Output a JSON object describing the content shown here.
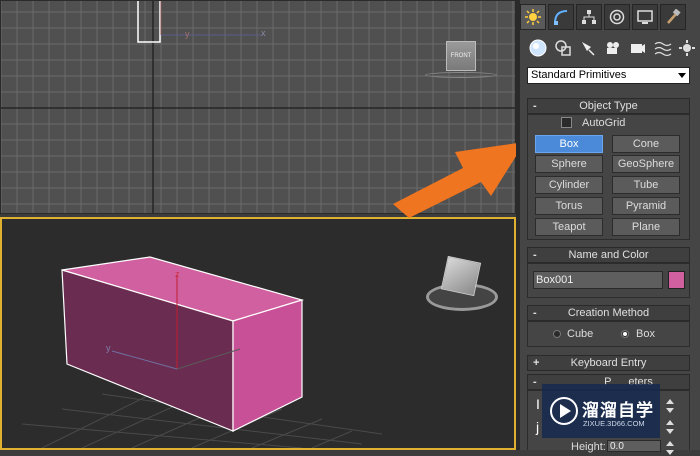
{
  "viewports": {
    "top": {
      "axis_x": "x",
      "axis_y": "y",
      "viewcube_label": "FRONT"
    },
    "perspective": {
      "axis_z": "z",
      "axis_y": "y"
    }
  },
  "command_panel": {
    "tabs": [
      "create-icon",
      "modify-icon",
      "hierarchy-icon",
      "motion-icon",
      "display-icon",
      "utilities-icon"
    ],
    "subtabs": [
      "geometry-icon",
      "shapes-icon",
      "lights-icon",
      "cameras-icon",
      "helpers-icon",
      "spacewarps-icon",
      "systems-icon"
    ],
    "category_dropdown": "Standard Primitives",
    "object_type": {
      "title": "Object Type",
      "collapse_sign": "-",
      "autogrid_label": "AutoGrid",
      "buttons": [
        "Box",
        "Cone",
        "Sphere",
        "GeoSphere",
        "Cylinder",
        "Tube",
        "Torus",
        "Pyramid",
        "Teapot",
        "Plane"
      ],
      "selected": "Box"
    },
    "name_and_color": {
      "title": "Name and Color",
      "collapse_sign": "-",
      "name_value": "Box001",
      "color": "#d060a0"
    },
    "creation_method": {
      "title": "Creation Method",
      "collapse_sign": "-",
      "options": [
        "Cube",
        "Box"
      ],
      "selected": "Box"
    },
    "keyboard_entry": {
      "title": "Keyboard Entry",
      "collapse_sign": "+"
    },
    "parameters": {
      "title_fragment_left": "P",
      "title_fragment_right": "eters",
      "collapse_sign": "-",
      "height_label": "Height:",
      "height_value": "0.0",
      "length_glimpse": "I",
      "width_glimpse": "j"
    }
  },
  "watermark": {
    "site": "溜溜自学",
    "url": "ZIXUE.3D66.COM"
  },
  "colors": {
    "arrow": "#f07520",
    "box": "#c0508c",
    "selected_button": "#4a8ad8"
  }
}
